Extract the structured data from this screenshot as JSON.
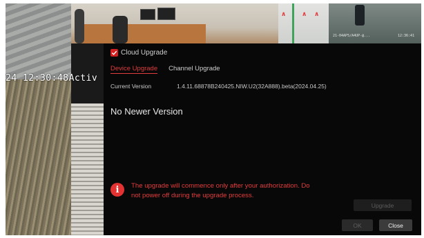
{
  "osd": {
    "timestamp": "24 12:30:48Activ"
  },
  "cameras": {
    "top_right_label": "21-04AP5/A4UP-@...",
    "top_right_time": "12:36:41"
  },
  "dialog": {
    "cloud_upgrade_label": "Cloud Upgrade",
    "cloud_upgrade_checked": true,
    "tabs": [
      {
        "label": "Device Upgrade",
        "active": true
      },
      {
        "label": "Channel Upgrade",
        "active": false
      }
    ],
    "current_version_label": "Current Version",
    "current_version_value": "1.4.11.68878B240425.NIW.U2(32A888).beta(2024.04.25)",
    "status_message": "No Newer Version",
    "warning_line1": "The upgrade will commence only after your authorization. Do",
    "warning_line2": "not power off during the upgrade process.",
    "upgrade_button": "Upgrade",
    "ok_button": "OK",
    "close_button": "Close"
  },
  "colors": {
    "accent_red": "#e23c3c",
    "dialog_bg": "#080808"
  },
  "icons": {
    "checkbox": "check-icon",
    "warning": "warning-icon"
  }
}
